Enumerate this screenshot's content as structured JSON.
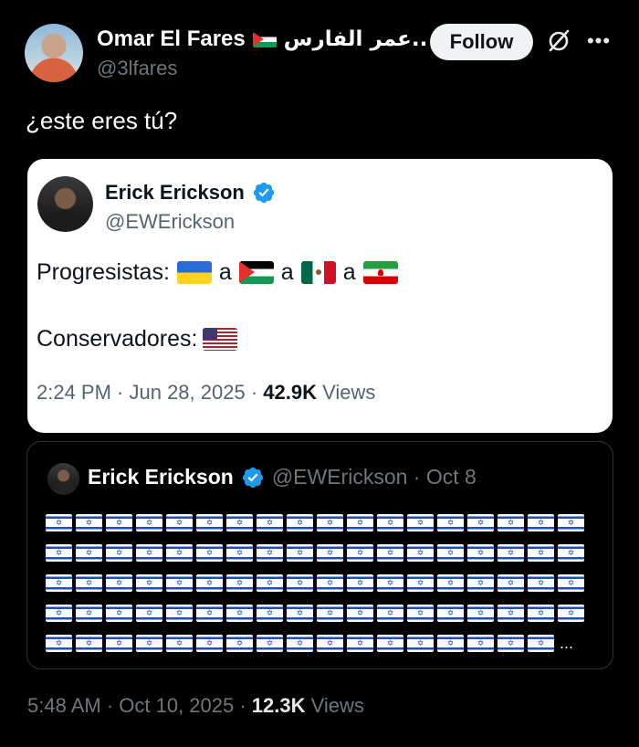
{
  "post": {
    "author_name": "Omar El Fares",
    "author_name_ar": "عمر الفارس..",
    "handle": "@3lfares",
    "follow_label": "Follow",
    "text": "¿este eres tú?",
    "time": "5:48 AM · Oct 10, 2025 · ",
    "views_count": "12.3K",
    "views_label": " Views"
  },
  "screenshot": {
    "name": "Erick Erickson",
    "handle": "@EWErickson",
    "line1_label": "Progresistas:",
    "connector": "a",
    "line2_label": "Conservadores:",
    "time": "2:24 PM · Jun 28, 2025 · ",
    "views_count": "42.9K",
    "views_label": " Views"
  },
  "quote": {
    "name": "Erick Erickson",
    "handle_date": "@EWErickson · Oct 8",
    "flag_rows": [
      18,
      18,
      18,
      18,
      17
    ],
    "ellipsis": "..."
  },
  "icons": {
    "verified": "verified-badge-icon",
    "grok": "grok-icon",
    "more": "more-options-icon"
  },
  "colors": {
    "verified_blue": "#1d9bf0",
    "background": "#000000",
    "muted_text": "#71767b"
  }
}
